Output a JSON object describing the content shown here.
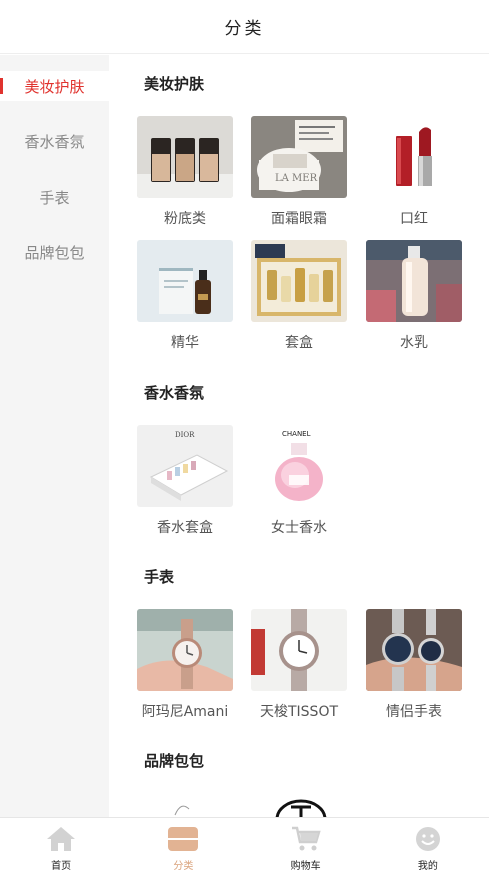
{
  "header": {
    "title": "分类"
  },
  "sidebar": {
    "items": [
      {
        "label": "美妆护肤",
        "active": true
      },
      {
        "label": "香水香氛",
        "active": false
      },
      {
        "label": "手表",
        "active": false
      },
      {
        "label": "品牌包包",
        "active": false
      }
    ]
  },
  "sections": [
    {
      "title": "美妆护肤",
      "items": [
        {
          "label": "粉底类"
        },
        {
          "label": "面霜眼霜",
          "product_text": "LA MER"
        },
        {
          "label": "口红"
        },
        {
          "label": "精华"
        },
        {
          "label": "套盒"
        },
        {
          "label": "水乳"
        }
      ]
    },
    {
      "title": "香水香氛",
      "items": [
        {
          "label": "香水套盒",
          "product_text": "DIOR"
        },
        {
          "label": "女士香水",
          "product_text": "CHANEL"
        }
      ]
    },
    {
      "title": "手表",
      "items": [
        {
          "label": "阿玛尼Amani"
        },
        {
          "label": "天梭TISSOT"
        },
        {
          "label": "情侣手表"
        }
      ]
    },
    {
      "title": "品牌包包",
      "items": []
    }
  ],
  "tabbar": {
    "items": [
      {
        "label": "首页",
        "icon": "home-icon",
        "active": false
      },
      {
        "label": "分类",
        "icon": "category-icon",
        "active": true
      },
      {
        "label": "购物车",
        "icon": "cart-icon",
        "active": false
      },
      {
        "label": "我的",
        "icon": "smiley-icon",
        "active": false
      }
    ]
  },
  "colors": {
    "accent": "#e0332e",
    "tab_active": "#d9a27b",
    "sidebar_bg": "#f5f5f5"
  }
}
